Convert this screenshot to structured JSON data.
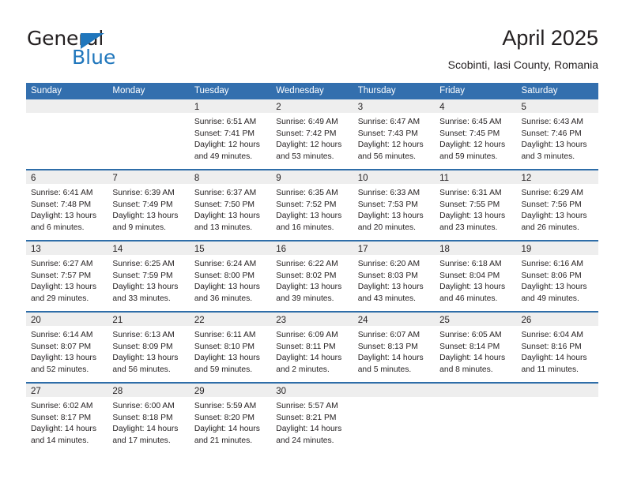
{
  "brand": {
    "name_part1": "General",
    "name_part2": "Blue",
    "triangle_color": "#1f76bc"
  },
  "header": {
    "title": "April 2025",
    "subtitle": "Scobinti, Iasi County, Romania"
  },
  "theme": {
    "header_blue": "#336fae",
    "row_divider_blue": "#2e6da8",
    "day_band_gray": "#eeeeee",
    "text_color": "#231f20"
  },
  "weekdays": [
    "Sunday",
    "Monday",
    "Tuesday",
    "Wednesday",
    "Thursday",
    "Friday",
    "Saturday"
  ],
  "weeks": [
    {
      "days": [
        {
          "number": "",
          "lines": []
        },
        {
          "number": "",
          "lines": []
        },
        {
          "number": "1",
          "lines": [
            "Sunrise: 6:51 AM",
            "Sunset: 7:41 PM",
            "Daylight: 12 hours",
            "and 49 minutes."
          ]
        },
        {
          "number": "2",
          "lines": [
            "Sunrise: 6:49 AM",
            "Sunset: 7:42 PM",
            "Daylight: 12 hours",
            "and 53 minutes."
          ]
        },
        {
          "number": "3",
          "lines": [
            "Sunrise: 6:47 AM",
            "Sunset: 7:43 PM",
            "Daylight: 12 hours",
            "and 56 minutes."
          ]
        },
        {
          "number": "4",
          "lines": [
            "Sunrise: 6:45 AM",
            "Sunset: 7:45 PM",
            "Daylight: 12 hours",
            "and 59 minutes."
          ]
        },
        {
          "number": "5",
          "lines": [
            "Sunrise: 6:43 AM",
            "Sunset: 7:46 PM",
            "Daylight: 13 hours",
            "and 3 minutes."
          ]
        }
      ]
    },
    {
      "days": [
        {
          "number": "6",
          "lines": [
            "Sunrise: 6:41 AM",
            "Sunset: 7:48 PM",
            "Daylight: 13 hours",
            "and 6 minutes."
          ]
        },
        {
          "number": "7",
          "lines": [
            "Sunrise: 6:39 AM",
            "Sunset: 7:49 PM",
            "Daylight: 13 hours",
            "and 9 minutes."
          ]
        },
        {
          "number": "8",
          "lines": [
            "Sunrise: 6:37 AM",
            "Sunset: 7:50 PM",
            "Daylight: 13 hours",
            "and 13 minutes."
          ]
        },
        {
          "number": "9",
          "lines": [
            "Sunrise: 6:35 AM",
            "Sunset: 7:52 PM",
            "Daylight: 13 hours",
            "and 16 minutes."
          ]
        },
        {
          "number": "10",
          "lines": [
            "Sunrise: 6:33 AM",
            "Sunset: 7:53 PM",
            "Daylight: 13 hours",
            "and 20 minutes."
          ]
        },
        {
          "number": "11",
          "lines": [
            "Sunrise: 6:31 AM",
            "Sunset: 7:55 PM",
            "Daylight: 13 hours",
            "and 23 minutes."
          ]
        },
        {
          "number": "12",
          "lines": [
            "Sunrise: 6:29 AM",
            "Sunset: 7:56 PM",
            "Daylight: 13 hours",
            "and 26 minutes."
          ]
        }
      ]
    },
    {
      "days": [
        {
          "number": "13",
          "lines": [
            "Sunrise: 6:27 AM",
            "Sunset: 7:57 PM",
            "Daylight: 13 hours",
            "and 29 minutes."
          ]
        },
        {
          "number": "14",
          "lines": [
            "Sunrise: 6:25 AM",
            "Sunset: 7:59 PM",
            "Daylight: 13 hours",
            "and 33 minutes."
          ]
        },
        {
          "number": "15",
          "lines": [
            "Sunrise: 6:24 AM",
            "Sunset: 8:00 PM",
            "Daylight: 13 hours",
            "and 36 minutes."
          ]
        },
        {
          "number": "16",
          "lines": [
            "Sunrise: 6:22 AM",
            "Sunset: 8:02 PM",
            "Daylight: 13 hours",
            "and 39 minutes."
          ]
        },
        {
          "number": "17",
          "lines": [
            "Sunrise: 6:20 AM",
            "Sunset: 8:03 PM",
            "Daylight: 13 hours",
            "and 43 minutes."
          ]
        },
        {
          "number": "18",
          "lines": [
            "Sunrise: 6:18 AM",
            "Sunset: 8:04 PM",
            "Daylight: 13 hours",
            "and 46 minutes."
          ]
        },
        {
          "number": "19",
          "lines": [
            "Sunrise: 6:16 AM",
            "Sunset: 8:06 PM",
            "Daylight: 13 hours",
            "and 49 minutes."
          ]
        }
      ]
    },
    {
      "days": [
        {
          "number": "20",
          "lines": [
            "Sunrise: 6:14 AM",
            "Sunset: 8:07 PM",
            "Daylight: 13 hours",
            "and 52 minutes."
          ]
        },
        {
          "number": "21",
          "lines": [
            "Sunrise: 6:13 AM",
            "Sunset: 8:09 PM",
            "Daylight: 13 hours",
            "and 56 minutes."
          ]
        },
        {
          "number": "22",
          "lines": [
            "Sunrise: 6:11 AM",
            "Sunset: 8:10 PM",
            "Daylight: 13 hours",
            "and 59 minutes."
          ]
        },
        {
          "number": "23",
          "lines": [
            "Sunrise: 6:09 AM",
            "Sunset: 8:11 PM",
            "Daylight: 14 hours",
            "and 2 minutes."
          ]
        },
        {
          "number": "24",
          "lines": [
            "Sunrise: 6:07 AM",
            "Sunset: 8:13 PM",
            "Daylight: 14 hours",
            "and 5 minutes."
          ]
        },
        {
          "number": "25",
          "lines": [
            "Sunrise: 6:05 AM",
            "Sunset: 8:14 PM",
            "Daylight: 14 hours",
            "and 8 minutes."
          ]
        },
        {
          "number": "26",
          "lines": [
            "Sunrise: 6:04 AM",
            "Sunset: 8:16 PM",
            "Daylight: 14 hours",
            "and 11 minutes."
          ]
        }
      ]
    },
    {
      "days": [
        {
          "number": "27",
          "lines": [
            "Sunrise: 6:02 AM",
            "Sunset: 8:17 PM",
            "Daylight: 14 hours",
            "and 14 minutes."
          ]
        },
        {
          "number": "28",
          "lines": [
            "Sunrise: 6:00 AM",
            "Sunset: 8:18 PM",
            "Daylight: 14 hours",
            "and 17 minutes."
          ]
        },
        {
          "number": "29",
          "lines": [
            "Sunrise: 5:59 AM",
            "Sunset: 8:20 PM",
            "Daylight: 14 hours",
            "and 21 minutes."
          ]
        },
        {
          "number": "30",
          "lines": [
            "Sunrise: 5:57 AM",
            "Sunset: 8:21 PM",
            "Daylight: 14 hours",
            "and 24 minutes."
          ]
        },
        {
          "number": "",
          "lines": []
        },
        {
          "number": "",
          "lines": []
        },
        {
          "number": "",
          "lines": []
        }
      ]
    }
  ]
}
